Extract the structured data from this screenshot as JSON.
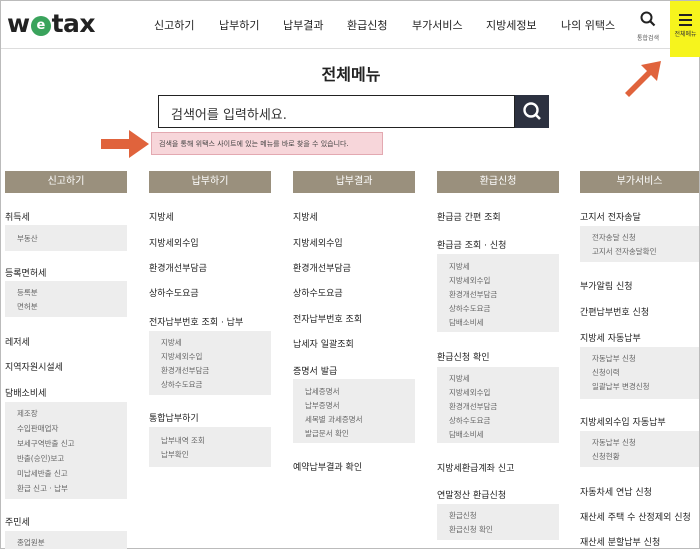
{
  "header": {
    "logo_pre": "w",
    "logo_o": "e",
    "logo_post": "tax",
    "nav": [
      "신고하기",
      "납부하기",
      "납부결과",
      "환급신청",
      "부가서비스",
      "지방세정보",
      "나의 위택스"
    ],
    "search_label": "통합검색",
    "menu_label": "전체메뉴"
  },
  "main": {
    "title": "전체메뉴",
    "search_placeholder": "검색어를 입력하세요.",
    "hint": "검색을 통해 위택스 사이트에 있는 메뉴를 바로 찾을 수 있습니다."
  },
  "columns": [
    {
      "header": "신고하기",
      "items": [
        "취득세",
        "등록면허세",
        "레저세",
        "지역자원시설세",
        "담배소비세",
        "주민세"
      ],
      "subs": [
        [
          "부동산"
        ],
        [
          "등록분",
          "면허분"
        ],
        [
          "제조장",
          "수입판매업자",
          "보세구역반출 신고",
          "반출(승인)보고",
          "미납세반출 신고",
          "환급 신고 · 납부"
        ],
        [
          "종업원분"
        ]
      ]
    },
    {
      "header": "납부하기",
      "items": [
        "지방세",
        "지방세외수입",
        "환경개선부담금",
        "상하수도요금",
        "전자납부번호 조회 · 납부",
        "통합납부하기"
      ],
      "subs": [
        [
          "지방세",
          "지방세외수입",
          "환경개선부담금",
          "상하수도요금"
        ],
        [
          "납부내역 조회",
          "납부확인"
        ]
      ]
    },
    {
      "header": "납부결과",
      "items": [
        "지방세",
        "지방세외수입",
        "환경개선부담금",
        "상하수도요금",
        "전자납부번호 조회",
        "납세자 일괄조회",
        "증명서 발급",
        "예약납부결과 확인"
      ],
      "subs": [
        [
          "납세증명서",
          "납부증명서",
          "세목별 과세증명서",
          "발급문서 확인"
        ]
      ]
    },
    {
      "header": "환급신청",
      "items": [
        "환급금 간편 조회",
        "환급금 조회 · 신청",
        "환급신청 확인",
        "지방세환급계좌 신고",
        "연말정산 환급신청"
      ],
      "subs": [
        [
          "지방세",
          "지방세외수입",
          "환경개선부담금",
          "상하수도요금",
          "담배소비세"
        ],
        [
          "지방세",
          "지방세외수입",
          "환경개선부담금",
          "상하수도요금",
          "담배소비세"
        ],
        [
          "환급신청",
          "환급신청 확인"
        ]
      ]
    },
    {
      "header": "부가서비스",
      "items": [
        "고지서 전자송달",
        "부가알림 신청",
        "간편납부번호 신청",
        "지방세 자동납부",
        "지방세외수입 자동납부",
        "자동차세 연납 신청",
        "재산세 주택 수 산정제외 신청",
        "재산세 분할납부 신청"
      ],
      "subs": [
        [
          "전자송달 신청",
          "고지서 전자송달확인"
        ],
        [
          "자동납부 신청",
          "신청이력",
          "일괄납부 변경신청"
        ],
        [
          "자동납부 신청",
          "신청현황"
        ]
      ]
    }
  ]
}
